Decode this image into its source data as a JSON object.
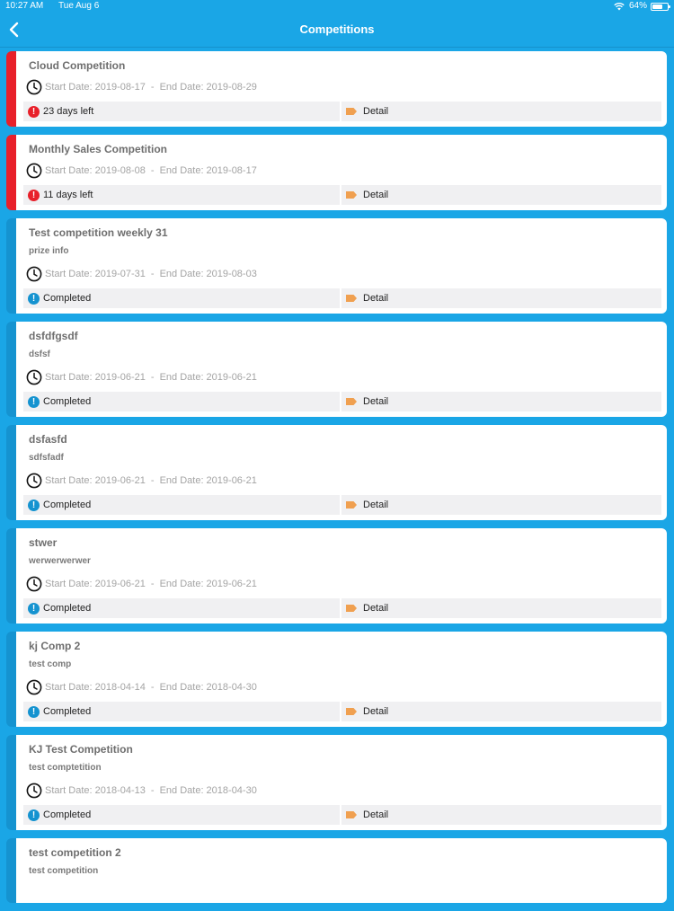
{
  "status_bar": {
    "time": "10:27 AM",
    "date": "Tue Aug 6",
    "battery": "64%"
  },
  "nav": {
    "title": "Competitions"
  },
  "detail_label": "Detail",
  "competitions": [
    {
      "title": "Cloud Competition",
      "subtitle": "",
      "start": "Start Date: 2019-08-17",
      "end": "End Date: 2019-08-29",
      "status": "23 days left",
      "urgent": true
    },
    {
      "title": "Monthly Sales Competition",
      "subtitle": "",
      "start": "Start Date: 2019-08-08",
      "end": "End Date: 2019-08-17",
      "status": "11 days left",
      "urgent": true
    },
    {
      "title": "Test competition weekly 31",
      "subtitle": "prize info",
      "start": "Start Date: 2019-07-31",
      "end": "End Date: 2019-08-03",
      "status": "Completed",
      "urgent": false
    },
    {
      "title": "dsfdfgsdf",
      "subtitle": "dsfsf",
      "start": "Start Date: 2019-06-21",
      "end": "End Date: 2019-06-21",
      "status": "Completed",
      "urgent": false
    },
    {
      "title": "dsfasfd",
      "subtitle": "sdfsfadf",
      "start": "Start Date: 2019-06-21",
      "end": "End Date: 2019-06-21",
      "status": "Completed",
      "urgent": false
    },
    {
      "title": "stwer",
      "subtitle": "werwerwerwer",
      "start": "Start Date: 2019-06-21",
      "end": "End Date: 2019-06-21",
      "status": "Completed",
      "urgent": false
    },
    {
      "title": "kj Comp 2",
      "subtitle": "test comp",
      "start": "Start Date: 2018-04-14",
      "end": "End Date: 2018-04-30",
      "status": "Completed",
      "urgent": false
    },
    {
      "title": "KJ Test Competition",
      "subtitle": "test comptetition",
      "start": "Start Date: 2018-04-13",
      "end": "End Date: 2018-04-30",
      "status": "Completed",
      "urgent": false
    },
    {
      "title": "test competition 2",
      "subtitle": "test competition",
      "start": "",
      "end": "",
      "status": "",
      "urgent": false
    }
  ],
  "colors": {
    "background": "#1aa6e6",
    "urgent": "#e8202a",
    "normal": "#1593d0",
    "detail_tag": "#f0a050"
  },
  "icons": {
    "back": "chevron-left-icon",
    "clock": "clock-icon",
    "alert": "exclamation-icon",
    "tag": "tag-icon"
  }
}
